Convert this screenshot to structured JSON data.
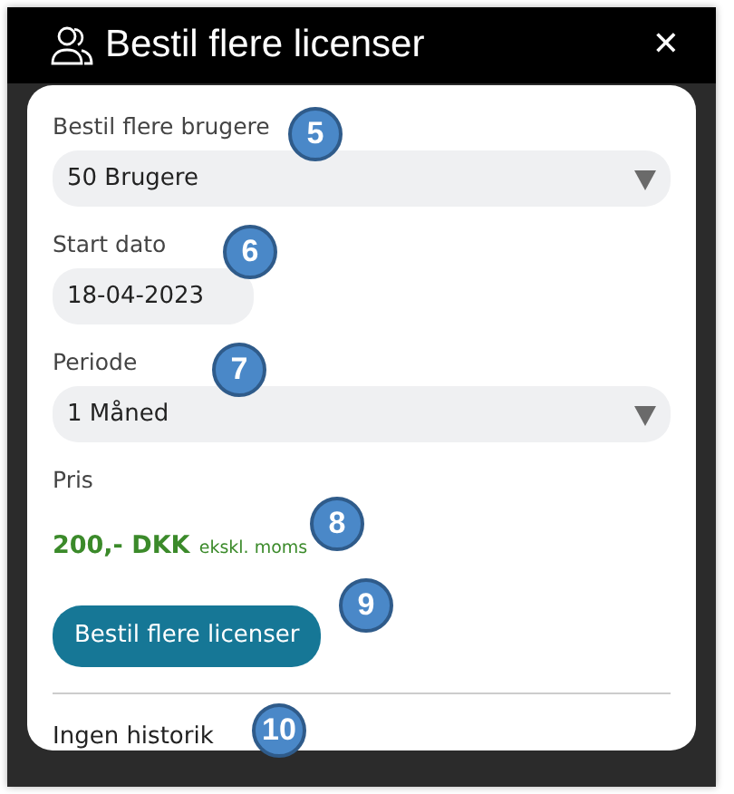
{
  "header": {
    "title": "Bestil flere licenser",
    "close": "✕"
  },
  "fields": [
    {
      "kind": "select",
      "label": "Bestil flere brugere",
      "value": "50 Brugere",
      "callout": "5"
    },
    {
      "kind": "date",
      "label": "Start dato",
      "value": "18-04-2023",
      "callout": "6"
    },
    {
      "kind": "select",
      "label": "Periode",
      "value": "1 Måned",
      "callout": "7"
    }
  ],
  "price": {
    "label": "Pris",
    "amount": "200,- DKK",
    "note": "ekskl. moms",
    "callout": "8"
  },
  "submit": {
    "label": "Bestil flere licenser",
    "callout": "9"
  },
  "history": {
    "text": "Ingen historik",
    "callout": "10"
  }
}
